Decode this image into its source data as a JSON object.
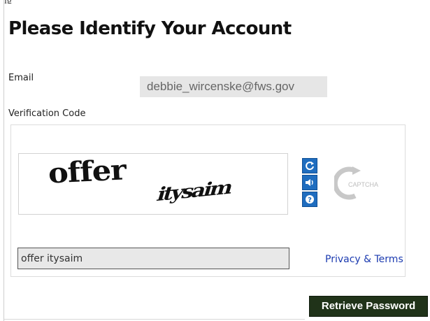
{
  "page": {
    "title": "Please Identify Your Account"
  },
  "form": {
    "email_label": "Email",
    "email_value": "debbie_wircenske@fws.gov",
    "verification_label": "Verification Code",
    "response_value": "offer itysaim",
    "privacy_link": "Privacy & Terms",
    "submit_label": "Retrieve Password"
  },
  "captcha": {
    "word_1": "offer",
    "word_2": "itysaim",
    "buttons": [
      {
        "icon": "refresh-icon"
      },
      {
        "icon": "audio-icon"
      },
      {
        "icon": "help-icon"
      }
    ],
    "logo_text": "CAPTCHA"
  },
  "colors": {
    "button_bg": "#203319",
    "captcha_button": "#1f6dbf",
    "link": "#1c3bb0"
  }
}
